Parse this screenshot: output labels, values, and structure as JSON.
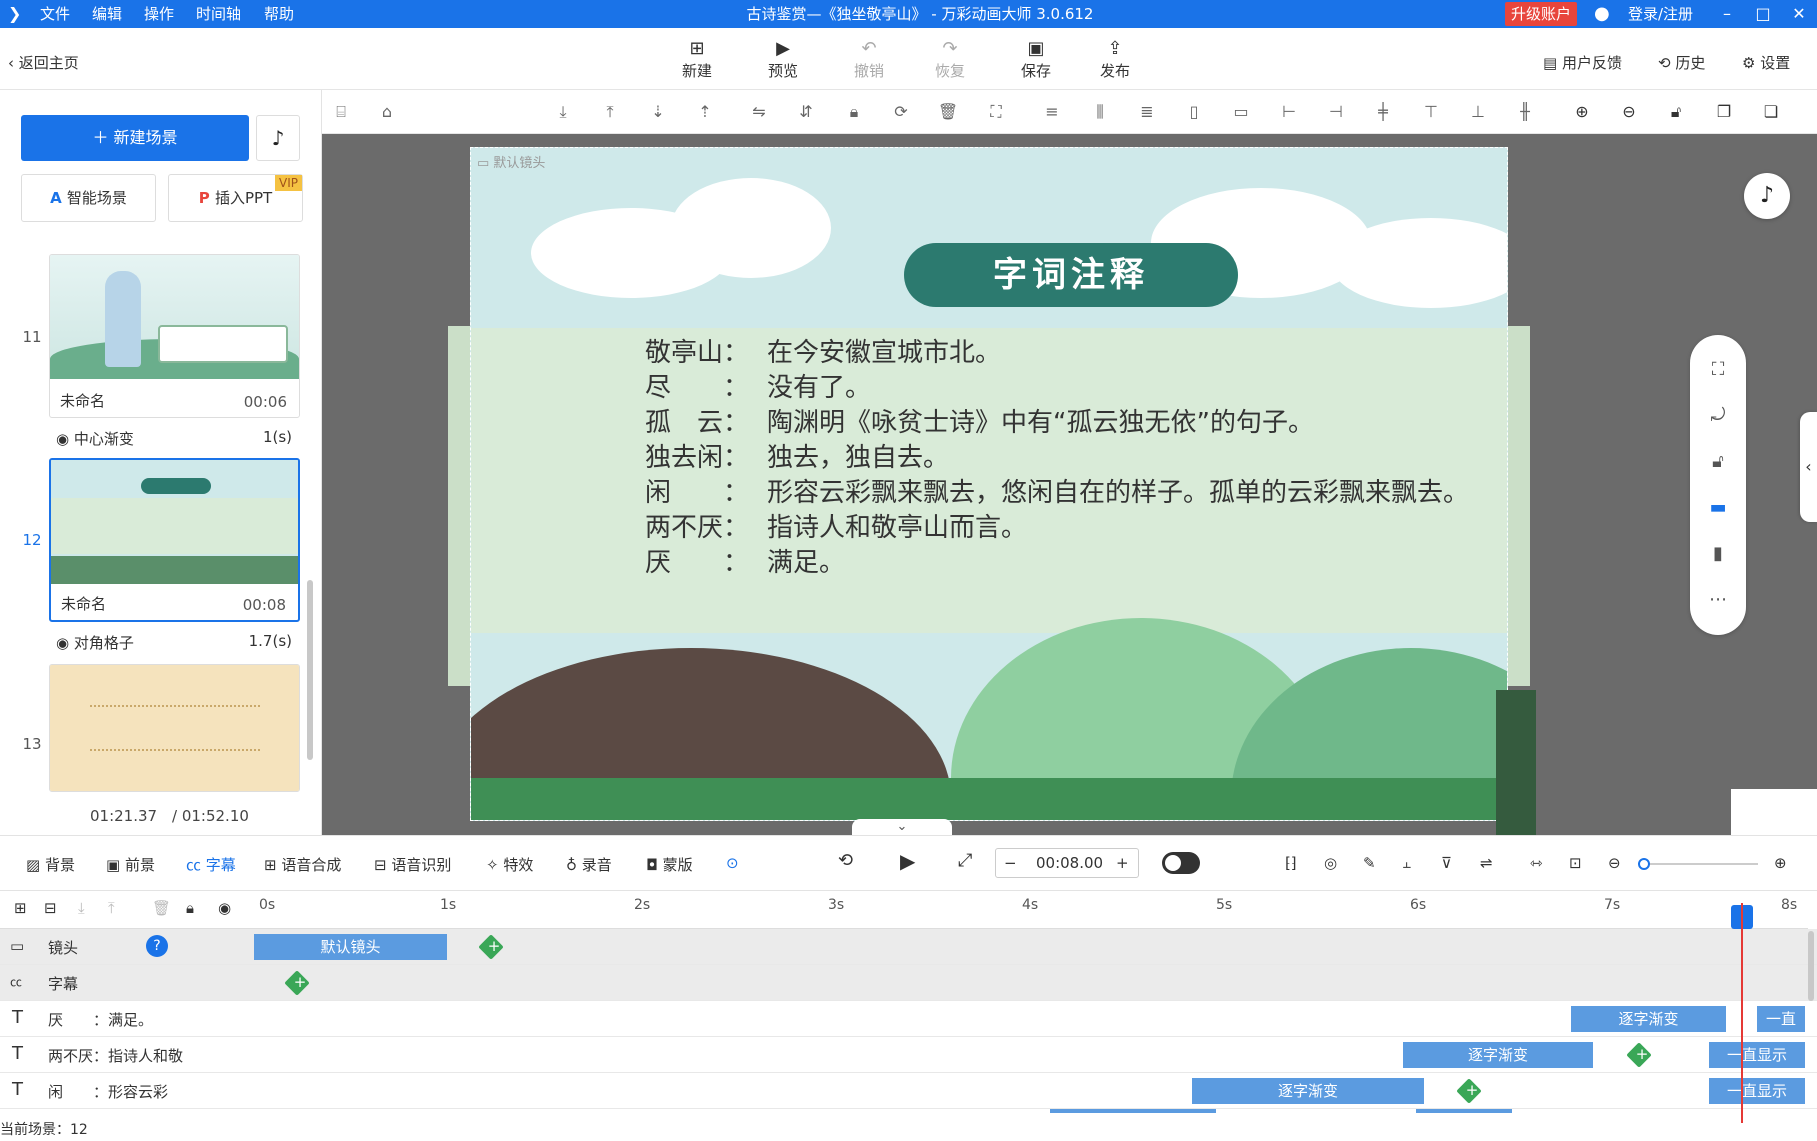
{
  "titlebar": {
    "menu": [
      "文件",
      "编辑",
      "操作",
      "时间轴",
      "帮助"
    ],
    "title": "古诗鉴赏—《独坐敬亭山》 - 万彩动画大师 3.0.612",
    "upgrade": "升级账户",
    "login": "登录/注册"
  },
  "toolbar": {
    "back": "返回主页",
    "new": "新建",
    "preview": "预览",
    "undo": "撤销",
    "redo": "恢复",
    "save": "保存",
    "publish": "发布",
    "feedback": "用户反馈",
    "history": "历史",
    "settings": "设置"
  },
  "left": {
    "new_scene": "新建场景",
    "smart_scene": "智能场景",
    "insert_ppt": "插入PPT",
    "vip": "VIP",
    "scenes": [
      {
        "num": "11",
        "name": "未命名",
        "time": "00:06",
        "transition": "中心渐变",
        "duration": "1(s)"
      },
      {
        "num": "12",
        "name": "未命名",
        "time": "00:08",
        "transition": "对角格子",
        "duration": "1.7(s)"
      },
      {
        "num": "13"
      }
    ],
    "time_current": "01:21.37",
    "time_total": "/ 01:52.10"
  },
  "slide": {
    "camera_label": "默认镜头",
    "title": "字词注释",
    "entries": [
      {
        "term": "敬亭山：",
        "def": "在今安徽宣城市北。"
      },
      {
        "term": "尽　　：",
        "def": "没有了。"
      },
      {
        "term": "孤　云：",
        "def": "陶渊明《咏贫士诗》中有“孤云独无依”的句子。"
      },
      {
        "term": "独去闲：",
        "def": "独去，独自去。"
      },
      {
        "term": "闲　　：",
        "def": "形容云彩飘来飘去，悠闲自在的样子。孤单的云彩飘来飘去。"
      },
      {
        "term": "两不厌：",
        "def": "指诗人和敬亭山而言。"
      },
      {
        "term": "厌　　：",
        "def": "满足。"
      }
    ]
  },
  "bottom": {
    "tabs": [
      "背景",
      "前景",
      "字幕",
      "语音合成",
      "语音识别",
      "特效",
      "录音",
      "蒙版"
    ],
    "active_tab": "字幕",
    "time": "00:08.00"
  },
  "timeline": {
    "ticks": [
      "0s",
      "1s",
      "2s",
      "3s",
      "4s",
      "5s",
      "6s",
      "7s",
      "8s"
    ],
    "rows": [
      {
        "label": "镜头",
        "clips": [
          {
            "text": "默认镜头"
          }
        ]
      },
      {
        "label": "字幕",
        "clips": []
      },
      {
        "label": "厌　　：满足。",
        "clips": [
          {
            "text": "逐字渐变"
          },
          {
            "text": "一直"
          }
        ]
      },
      {
        "label": "两不厌：指诗人和敬",
        "clips": [
          {
            "text": "逐字渐变"
          },
          {
            "text": "一直显示"
          }
        ]
      },
      {
        "label": "闲　　：形容云彩",
        "clips": [
          {
            "text": "逐字渐变"
          },
          {
            "text": "一直显示"
          }
        ]
      }
    ],
    "current_scene": "当前场景：12"
  }
}
